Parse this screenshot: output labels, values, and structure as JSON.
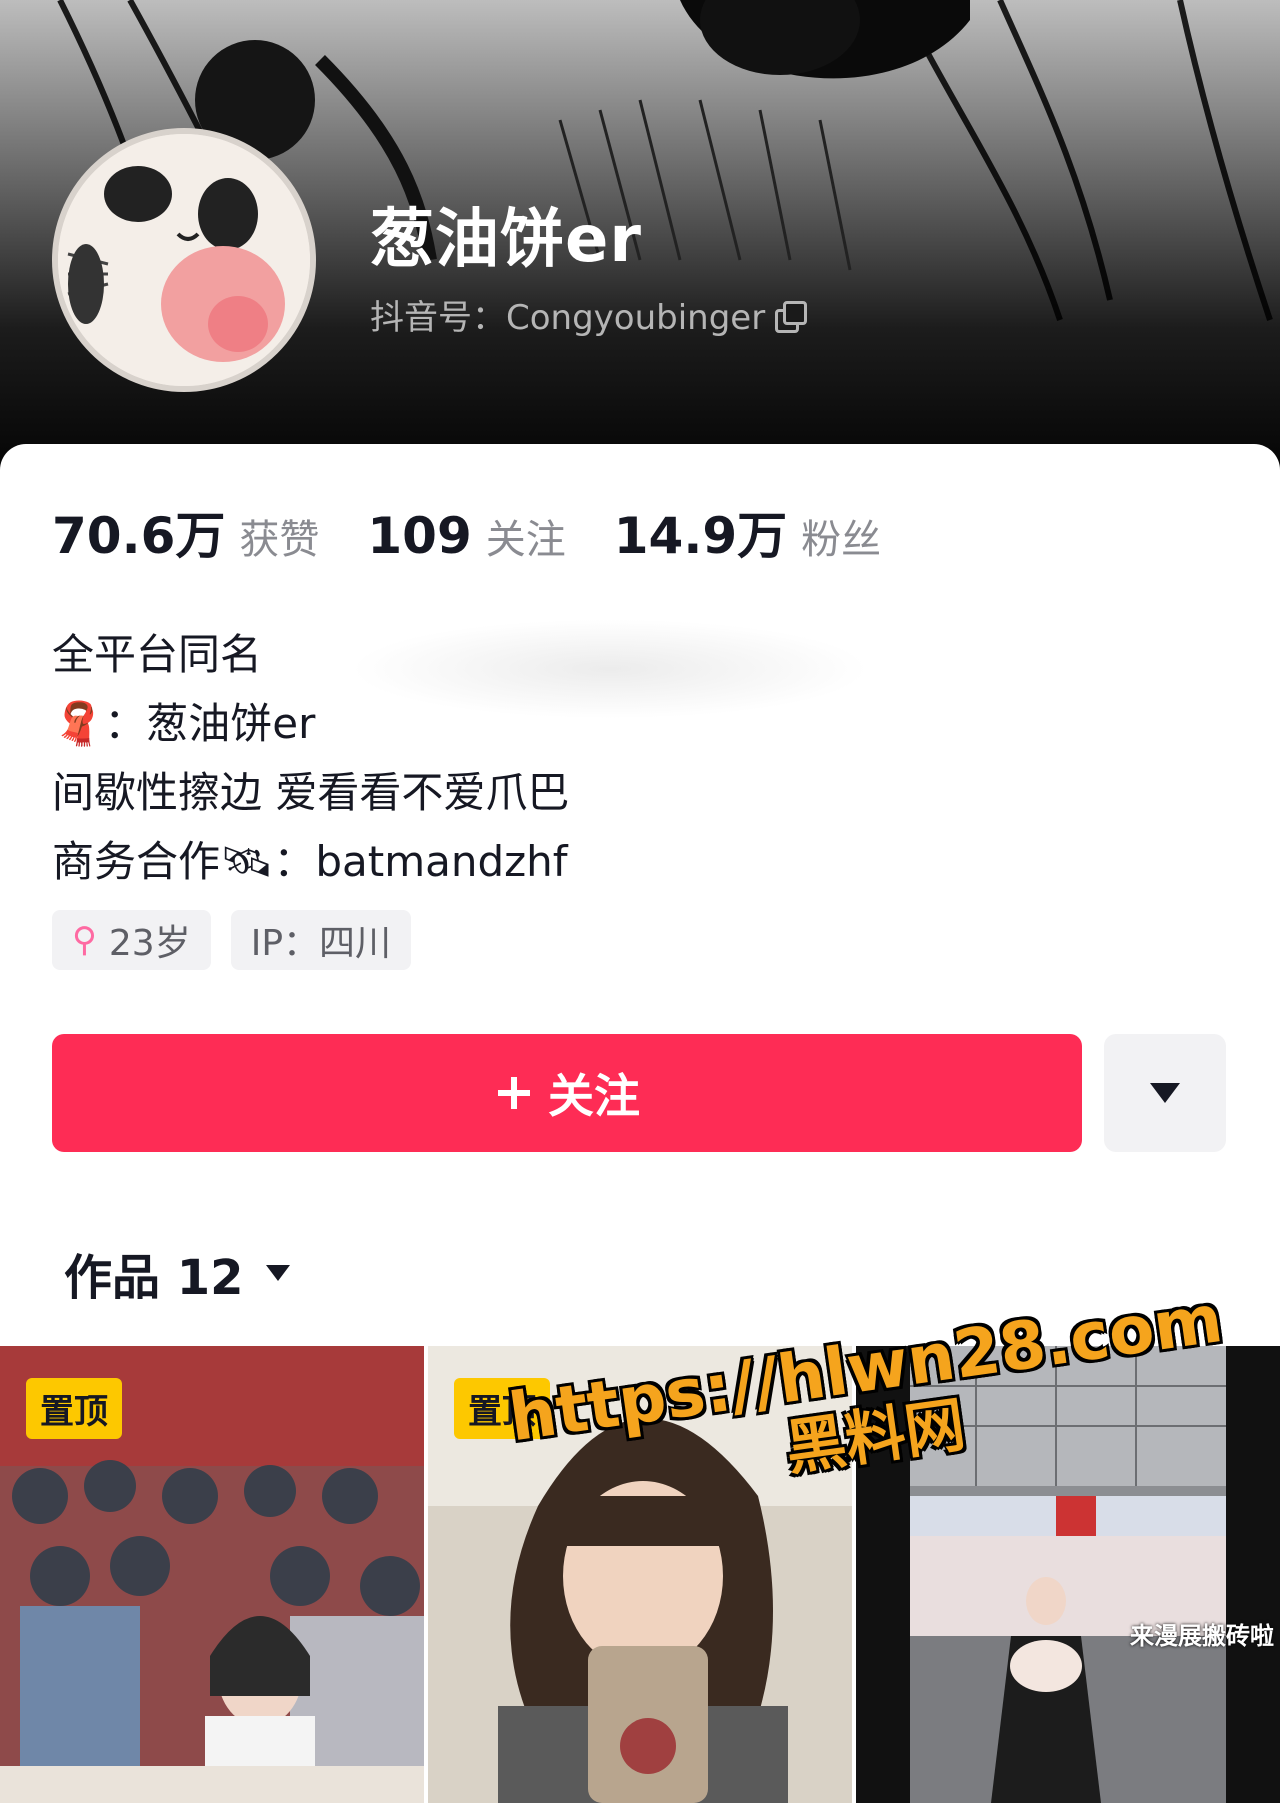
{
  "profile": {
    "nickname": "葱油饼er",
    "douyin_id": "抖音号：Congyoubinger"
  },
  "stats": [
    {
      "num": "70.6万",
      "label": "获赞"
    },
    {
      "num": "109",
      "label": "关注"
    },
    {
      "num": "14.9万",
      "label": "粉丝"
    }
  ],
  "bio": {
    "line1": "全平台同名",
    "line2_icon": "🧣",
    "line2": "：葱油饼er",
    "line3": "间歇性擦边 爱看看不爱爪巴",
    "line4_prefix": "商务合作",
    "line4_icon": "🛰",
    "line4": "：batmandzhf"
  },
  "tags": {
    "gender_icon": "⚲",
    "age": "23岁",
    "ip": "IP：四川"
  },
  "actions": {
    "follow_label": "关注",
    "follow_icon": "plus-icon"
  },
  "works": {
    "label": "作品 12"
  },
  "thumbnails": [
    {
      "pin": "置顶",
      "caption": ""
    },
    {
      "pin": "置顶",
      "caption": ""
    },
    {
      "pin": "",
      "caption": "来漫展搬砖啦"
    }
  ],
  "watermark": {
    "url": "https://hlwn28.com",
    "name": "黑料网"
  },
  "colors": {
    "accent": "#fe2c55",
    "pin": "#fdc800",
    "watermark": "#f5a41d"
  }
}
